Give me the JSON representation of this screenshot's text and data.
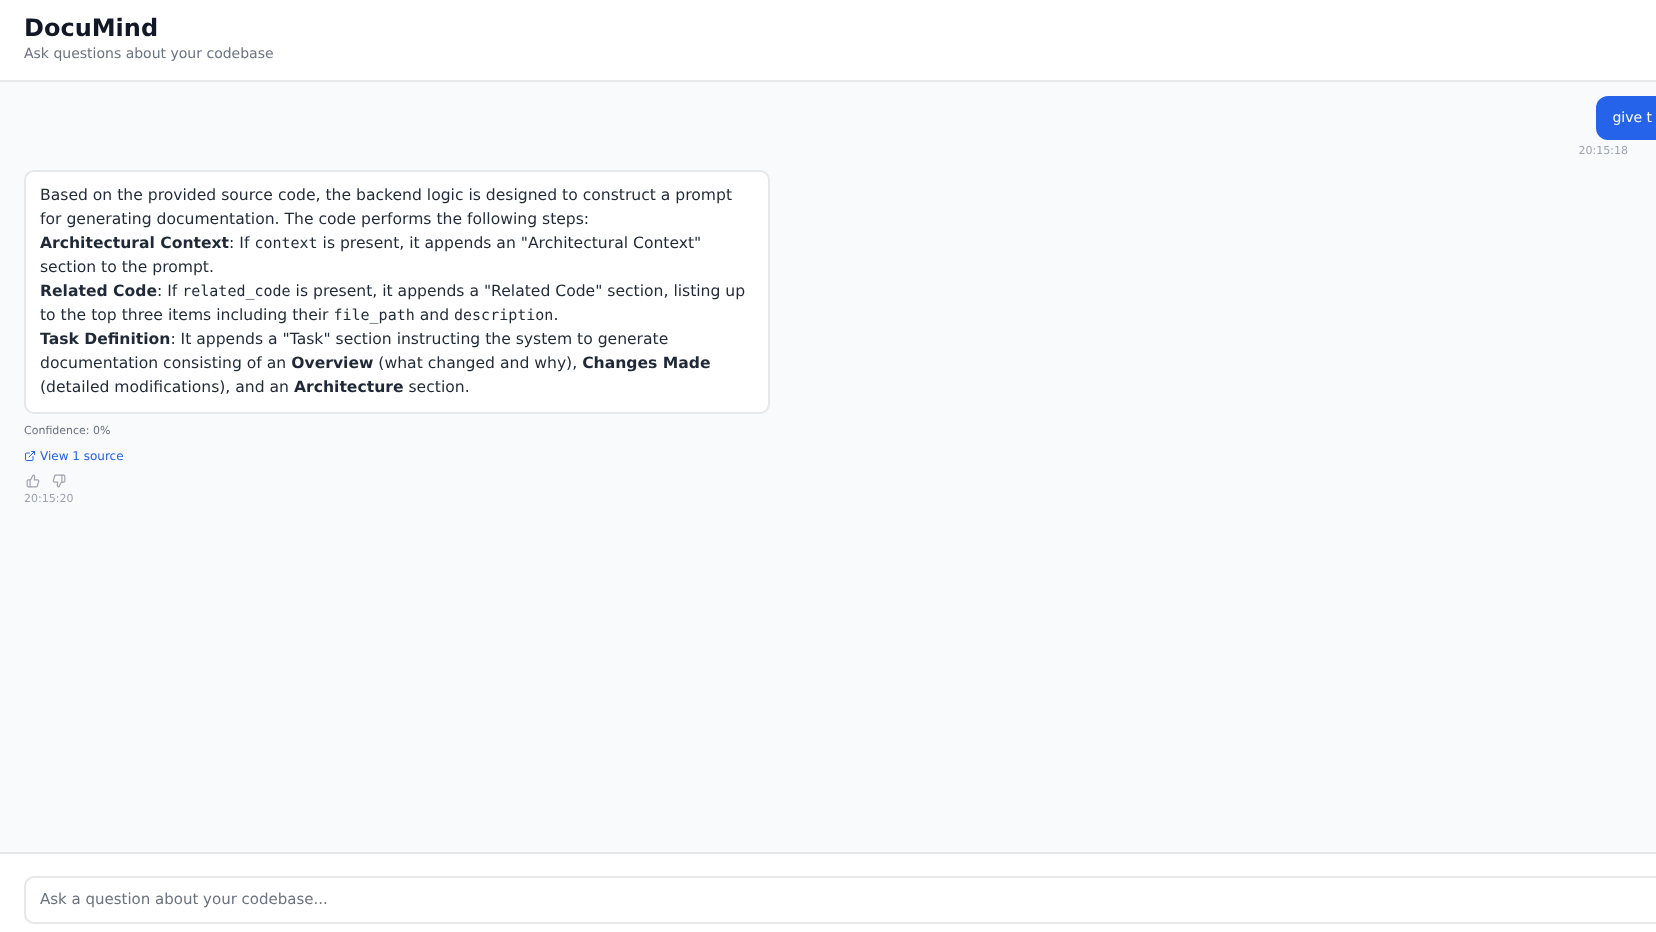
{
  "header": {
    "title": "DocuMind",
    "subtitle": "Ask questions about your codebase"
  },
  "user_message": {
    "text": "give t",
    "time": "20:15:18"
  },
  "assistant_message": {
    "lines": [
      [
        {
          "kind": "plain",
          "text": "Based on the provided source code, the backend logic is designed to construct a prompt for generating documentation. The code performs the following steps:"
        }
      ],
      [
        {
          "kind": "bold",
          "text": "Architectural Context"
        },
        {
          "kind": "plain",
          "text": ": If "
        },
        {
          "kind": "code",
          "text": "context"
        },
        {
          "kind": "plain",
          "text": " is present, it appends an \"Architectural Context\" section to the prompt."
        }
      ],
      [
        {
          "kind": "bold",
          "text": "Related Code"
        },
        {
          "kind": "plain",
          "text": ": If "
        },
        {
          "kind": "code",
          "text": "related_code"
        },
        {
          "kind": "plain",
          "text": " is present, it appends a \"Related Code\" section, listing up to the top three items including their "
        },
        {
          "kind": "code",
          "text": "file_path"
        },
        {
          "kind": "plain",
          "text": " and "
        },
        {
          "kind": "code",
          "text": "description"
        },
        {
          "kind": "plain",
          "text": "."
        }
      ],
      [
        {
          "kind": "bold",
          "text": "Task Definition"
        },
        {
          "kind": "plain",
          "text": ": It appends a \"Task\" section instructing the system to generate documentation consisting of an "
        },
        {
          "kind": "bold",
          "text": "Overview"
        },
        {
          "kind": "plain",
          "text": " (what changed and why), "
        },
        {
          "kind": "bold",
          "text": "Changes Made"
        },
        {
          "kind": "plain",
          "text": " (detailed modifications), and an "
        },
        {
          "kind": "bold",
          "text": "Architecture"
        },
        {
          "kind": "plain",
          "text": " section."
        }
      ]
    ],
    "confidence": "Confidence: 0%",
    "sources_link": "View 1 source",
    "time": "20:15:20"
  },
  "input": {
    "placeholder": "Ask a question about your codebase..."
  }
}
